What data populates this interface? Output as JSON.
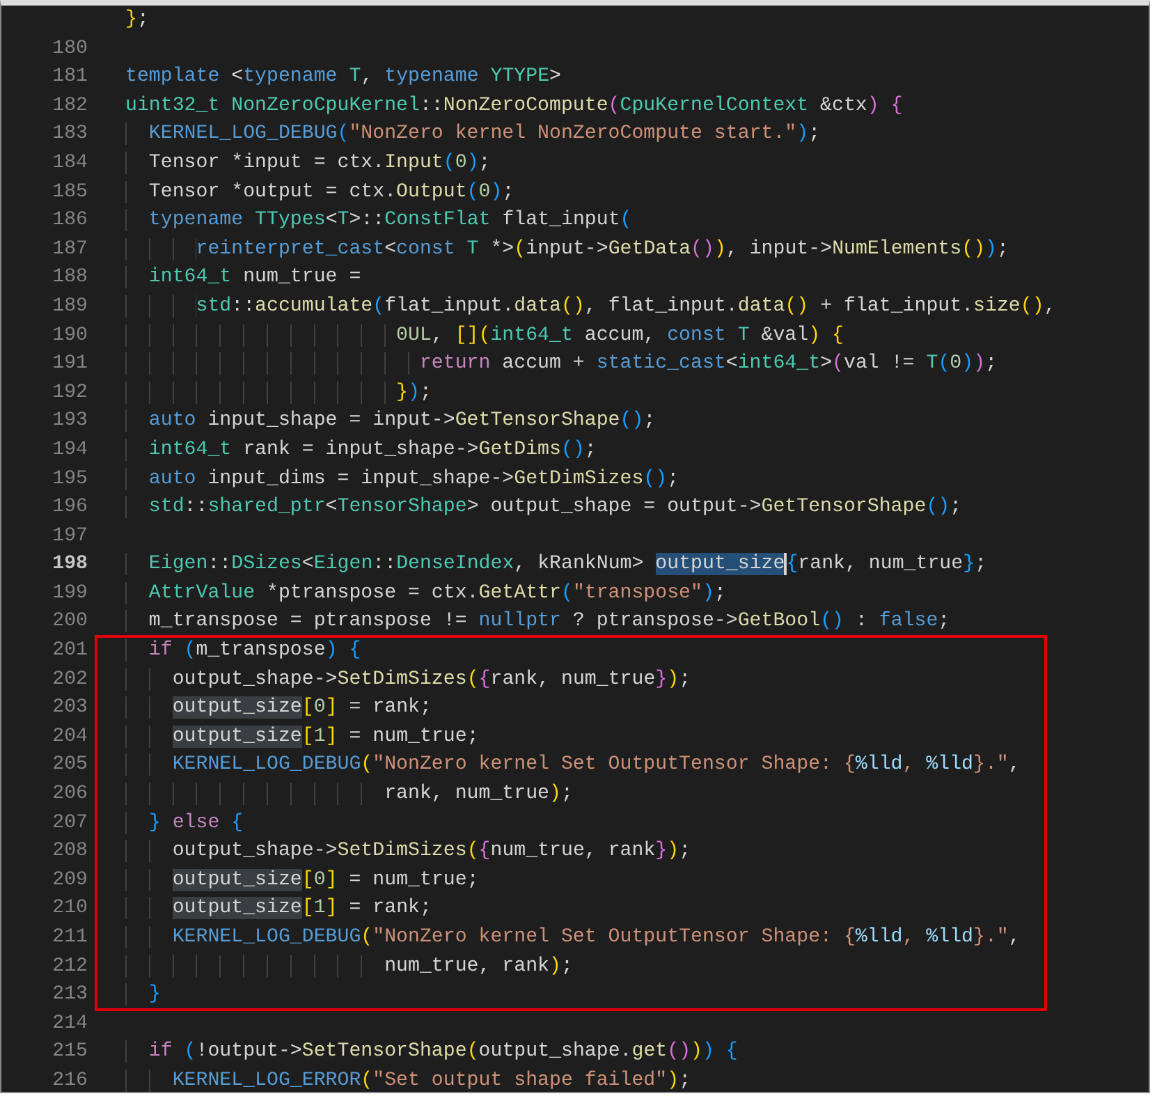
{
  "editor": {
    "sections": [
      {
        "boxed": false,
        "lines": [
          {
            "code": [
              {
                "kind": "y",
                "text": "}"
              },
              {
                "kind": "p",
                "text": ";"
              }
            ]
          },
          {
            "number": "180"
          },
          {
            "number": "181",
            "code": [
              {
                "kind": "k",
                "text": "template"
              },
              {
                "kind": "p",
                "text": " <"
              },
              {
                "kind": "k",
                "text": "typename"
              },
              {
                "kind": "t",
                "text": " T"
              },
              {
                "kind": "p",
                "text": ", "
              },
              {
                "kind": "k",
                "text": "typename"
              },
              {
                "kind": "t",
                "text": " YTYPE"
              },
              {
                "kind": "p",
                "text": ">"
              }
            ]
          },
          {
            "number": "182",
            "code": [
              {
                "kind": "t",
                "text": "uint32_t NonZeroCpuKernel"
              },
              {
                "kind": "p",
                "text": "::"
              },
              {
                "kind": "f",
                "text": "NonZeroCompute"
              },
              {
                "kind": "v",
                "text": "("
              },
              {
                "kind": "t",
                "text": "CpuKernelContext"
              },
              {
                "kind": "p",
                "text": " &ctx"
              },
              {
                "kind": "v",
                "text": ")"
              },
              {
                "kind": "v",
                "text": " {"
              }
            ]
          },
          {
            "number": "183",
            "code": [
              {
                "kind": "k",
                "text": "  KERNEL_LOG_DEBUG"
              },
              {
                "kind": "b",
                "text": "("
              },
              {
                "kind": "s",
                "text": "\"NonZero kernel NonZeroCompute start.\""
              },
              {
                "kind": "b",
                "text": ")"
              },
              {
                "kind": "p",
                "text": ";"
              }
            ]
          },
          {
            "number": "184",
            "code": [
              {
                "kind": "p",
                "text": "  Tensor *input = ctx."
              },
              {
                "kind": "f",
                "text": "Input"
              },
              {
                "kind": "b",
                "text": "("
              },
              {
                "kind": "n",
                "text": "0"
              },
              {
                "kind": "b",
                "text": ")"
              },
              {
                "kind": "p",
                "text": ";"
              }
            ]
          },
          {
            "number": "185",
            "code": [
              {
                "kind": "p",
                "text": "  Tensor *output = ctx."
              },
              {
                "kind": "f",
                "text": "Output"
              },
              {
                "kind": "b",
                "text": "("
              },
              {
                "kind": "n",
                "text": "0"
              },
              {
                "kind": "b",
                "text": ")"
              },
              {
                "kind": "p",
                "text": ";"
              }
            ]
          },
          {
            "number": "186",
            "code": [
              {
                "kind": "k",
                "text": "  typename"
              },
              {
                "kind": "t",
                "text": " TTypes"
              },
              {
                "kind": "p",
                "text": "<"
              },
              {
                "kind": "t",
                "text": "T"
              },
              {
                "kind": "p",
                "text": ">::"
              },
              {
                "kind": "t",
                "text": "ConstFlat"
              },
              {
                "kind": "p",
                "text": " flat_input"
              },
              {
                "kind": "b",
                "text": "("
              }
            ]
          },
          {
            "number": "187",
            "code": [
              {
                "kind": "k",
                "text": "      reinterpret_cast"
              },
              {
                "kind": "p",
                "text": "<"
              },
              {
                "kind": "k",
                "text": "const"
              },
              {
                "kind": "t",
                "text": " T"
              },
              {
                "kind": "p",
                "text": " *>"
              },
              {
                "kind": "y",
                "text": "("
              },
              {
                "kind": "p",
                "text": "input->"
              },
              {
                "kind": "f",
                "text": "GetData"
              },
              {
                "kind": "v",
                "text": "()"
              },
              {
                "kind": "y",
                "text": ")"
              },
              {
                "kind": "p",
                "text": ", input->"
              },
              {
                "kind": "f",
                "text": "NumElements"
              },
              {
                "kind": "y",
                "text": "()"
              },
              {
                "kind": "b",
                "text": ")"
              },
              {
                "kind": "p",
                "text": ";"
              }
            ]
          },
          {
            "number": "188",
            "code": [
              {
                "kind": "t",
                "text": "  int64_t"
              },
              {
                "kind": "p",
                "text": " num_true ="
              }
            ]
          },
          {
            "number": "189",
            "code": [
              {
                "kind": "t",
                "text": "      std"
              },
              {
                "kind": "p",
                "text": "::"
              },
              {
                "kind": "f",
                "text": "accumulate"
              },
              {
                "kind": "b",
                "text": "("
              },
              {
                "kind": "p",
                "text": "flat_input."
              },
              {
                "kind": "f",
                "text": "data"
              },
              {
                "kind": "y",
                "text": "()"
              },
              {
                "kind": "p",
                "text": ", flat_input."
              },
              {
                "kind": "f",
                "text": "data"
              },
              {
                "kind": "y",
                "text": "()"
              },
              {
                "kind": "p",
                "text": " + flat_input."
              },
              {
                "kind": "f",
                "text": "size"
              },
              {
                "kind": "y",
                "text": "()"
              },
              {
                "kind": "p",
                "text": ","
              }
            ]
          },
          {
            "number": "190",
            "code": [
              {
                "kind": "n",
                "text": "                       0UL"
              },
              {
                "kind": "p",
                "text": ", "
              },
              {
                "kind": "y",
                "text": "[]("
              },
              {
                "kind": "t",
                "text": "int64_t"
              },
              {
                "kind": "p",
                "text": " accum, "
              },
              {
                "kind": "k",
                "text": "const"
              },
              {
                "kind": "t",
                "text": " T"
              },
              {
                "kind": "p",
                "text": " &val"
              },
              {
                "kind": "y",
                "text": ")"
              },
              {
                "kind": "y",
                "text": " {"
              }
            ]
          },
          {
            "number": "191",
            "code": [
              {
                "kind": "c",
                "text": "                         return"
              },
              {
                "kind": "p",
                "text": " accum + "
              },
              {
                "kind": "k",
                "text": "static_cast"
              },
              {
                "kind": "p",
                "text": "<"
              },
              {
                "kind": "t",
                "text": "int64_t"
              },
              {
                "kind": "p",
                "text": ">"
              },
              {
                "kind": "v",
                "text": "("
              },
              {
                "kind": "p",
                "text": "val != "
              },
              {
                "kind": "t",
                "text": "T"
              },
              {
                "kind": "b",
                "text": "("
              },
              {
                "kind": "n",
                "text": "0"
              },
              {
                "kind": "b",
                "text": ")"
              },
              {
                "kind": "v",
                "text": ")"
              },
              {
                "kind": "p",
                "text": ";"
              }
            ]
          },
          {
            "number": "192",
            "code": [
              {
                "kind": "y",
                "text": "                       }"
              },
              {
                "kind": "b",
                "text": ")"
              },
              {
                "kind": "p",
                "text": ";"
              }
            ]
          },
          {
            "number": "193",
            "code": [
              {
                "kind": "k",
                "text": "  auto"
              },
              {
                "kind": "p",
                "text": " input_shape = input->"
              },
              {
                "kind": "f",
                "text": "GetTensorShape"
              },
              {
                "kind": "b",
                "text": "()"
              },
              {
                "kind": "p",
                "text": ";"
              }
            ]
          },
          {
            "number": "194",
            "code": [
              {
                "kind": "t",
                "text": "  int64_t"
              },
              {
                "kind": "p",
                "text": " rank = input_shape->"
              },
              {
                "kind": "f",
                "text": "GetDims"
              },
              {
                "kind": "b",
                "text": "()"
              },
              {
                "kind": "p",
                "text": ";"
              }
            ]
          },
          {
            "number": "195",
            "code": [
              {
                "kind": "k",
                "text": "  auto"
              },
              {
                "kind": "p",
                "text": " input_dims = input_shape->"
              },
              {
                "kind": "f",
                "text": "GetDimSizes"
              },
              {
                "kind": "b",
                "text": "()"
              },
              {
                "kind": "p",
                "text": ";"
              }
            ]
          },
          {
            "number": "196",
            "code": [
              {
                "kind": "t",
                "text": "  std"
              },
              {
                "kind": "p",
                "text": "::"
              },
              {
                "kind": "t",
                "text": "shared_ptr"
              },
              {
                "kind": "p",
                "text": "<"
              },
              {
                "kind": "t",
                "text": "TensorShape"
              },
              {
                "kind": "p",
                "text": "> output_shape = output->"
              },
              {
                "kind": "f",
                "text": "GetTensorShape"
              },
              {
                "kind": "b",
                "text": "()"
              },
              {
                "kind": "p",
                "text": ";"
              }
            ]
          },
          {
            "number": "197"
          },
          {
            "number": "198",
            "current": true,
            "code": [
              {
                "kind": "t",
                "text": "  Eigen"
              },
              {
                "kind": "p",
                "text": "::"
              },
              {
                "kind": "t",
                "text": "DSizes"
              },
              {
                "kind": "p",
                "text": "<"
              },
              {
                "kind": "t",
                "text": "Eigen"
              },
              {
                "kind": "p",
                "text": "::"
              },
              {
                "kind": "t",
                "text": "DenseIndex"
              },
              {
                "kind": "p",
                "text": ", kRankNum> "
              },
              {
                "kind": "sel",
                "text": "output_size"
              },
              {
                "kind": "b",
                "text": "{"
              },
              {
                "kind": "p",
                "text": "rank, num_true"
              },
              {
                "kind": "b",
                "text": "}"
              },
              {
                "kind": "p",
                "text": ";"
              }
            ]
          },
          {
            "number": "199",
            "code": [
              {
                "kind": "t",
                "text": "  AttrValue"
              },
              {
                "kind": "p",
                "text": " *ptranspose = ctx."
              },
              {
                "kind": "f",
                "text": "GetAttr"
              },
              {
                "kind": "b",
                "text": "("
              },
              {
                "kind": "s",
                "text": "\"transpose\""
              },
              {
                "kind": "b",
                "text": ")"
              },
              {
                "kind": "p",
                "text": ";"
              }
            ]
          },
          {
            "number": "200",
            "code": [
              {
                "kind": "p",
                "text": "  m_transpose = ptranspose != "
              },
              {
                "kind": "k",
                "text": "nullptr"
              },
              {
                "kind": "p",
                "text": " ? ptranspose->"
              },
              {
                "kind": "f",
                "text": "GetBool"
              },
              {
                "kind": "b",
                "text": "()"
              },
              {
                "kind": "p",
                "text": " : "
              },
              {
                "kind": "k",
                "text": "false"
              },
              {
                "kind": "p",
                "text": ";"
              }
            ]
          }
        ]
      },
      {
        "boxed": true,
        "lines": [
          {
            "number": "201",
            "code": [
              {
                "kind": "c",
                "text": "  if"
              },
              {
                "kind": "b",
                "text": " ("
              },
              {
                "kind": "p",
                "text": "m_transpose"
              },
              {
                "kind": "b",
                "text": ")"
              },
              {
                "kind": "b",
                "text": " {"
              }
            ]
          },
          {
            "number": "202",
            "code": [
              {
                "kind": "p",
                "text": "    output_shape->"
              },
              {
                "kind": "f",
                "text": "SetDimSizes"
              },
              {
                "kind": "y",
                "text": "("
              },
              {
                "kind": "v",
                "text": "{"
              },
              {
                "kind": "p",
                "text": "rank, num_true"
              },
              {
                "kind": "v",
                "text": "}"
              },
              {
                "kind": "y",
                "text": ")"
              },
              {
                "kind": "p",
                "text": ";"
              }
            ]
          },
          {
            "number": "203",
            "code": [
              {
                "kind": "hl",
                "text": "    output_size"
              },
              {
                "kind": "y",
                "text": "["
              },
              {
                "kind": "n",
                "text": "0"
              },
              {
                "kind": "y",
                "text": "]"
              },
              {
                "kind": "p",
                "text": " = rank;"
              }
            ]
          },
          {
            "number": "204",
            "code": [
              {
                "kind": "hl",
                "text": "    output_size"
              },
              {
                "kind": "y",
                "text": "["
              },
              {
                "kind": "n",
                "text": "1"
              },
              {
                "kind": "y",
                "text": "]"
              },
              {
                "kind": "p",
                "text": " = num_true;"
              }
            ]
          },
          {
            "number": "205",
            "code": [
              {
                "kind": "k",
                "text": "    KERNEL_LOG_DEBUG"
              },
              {
                "kind": "y",
                "text": "("
              },
              {
                "kind": "s",
                "text": "\"NonZero kernel Set OutputTensor Shape: {"
              },
              {
                "kind": "e",
                "text": "%lld"
              },
              {
                "kind": "s",
                "text": ", "
              },
              {
                "kind": "e",
                "text": "%lld"
              },
              {
                "kind": "s",
                "text": "}.\""
              },
              {
                "kind": "p",
                "text": ","
              }
            ]
          },
          {
            "number": "206",
            "code": [
              {
                "kind": "p",
                "text": "                      rank, num_true"
              },
              {
                "kind": "y",
                "text": ")"
              },
              {
                "kind": "p",
                "text": ";"
              }
            ]
          },
          {
            "number": "207",
            "code": [
              {
                "kind": "b",
                "text": "  }"
              },
              {
                "kind": "c",
                "text": " else"
              },
              {
                "kind": "b",
                "text": " {"
              }
            ]
          },
          {
            "number": "208",
            "code": [
              {
                "kind": "p",
                "text": "    output_shape->"
              },
              {
                "kind": "f",
                "text": "SetDimSizes"
              },
              {
                "kind": "y",
                "text": "("
              },
              {
                "kind": "v",
                "text": "{"
              },
              {
                "kind": "p",
                "text": "num_true, rank"
              },
              {
                "kind": "v",
                "text": "}"
              },
              {
                "kind": "y",
                "text": ")"
              },
              {
                "kind": "p",
                "text": ";"
              }
            ]
          },
          {
            "number": "209",
            "code": [
              {
                "kind": "hl",
                "text": "    output_size"
              },
              {
                "kind": "y",
                "text": "["
              },
              {
                "kind": "n",
                "text": "0"
              },
              {
                "kind": "y",
                "text": "]"
              },
              {
                "kind": "p",
                "text": " = num_true;"
              }
            ]
          },
          {
            "number": "210",
            "code": [
              {
                "kind": "hl",
                "text": "    output_size"
              },
              {
                "kind": "y",
                "text": "["
              },
              {
                "kind": "n",
                "text": "1"
              },
              {
                "kind": "y",
                "text": "]"
              },
              {
                "kind": "p",
                "text": " = rank;"
              }
            ]
          },
          {
            "number": "211",
            "code": [
              {
                "kind": "k",
                "text": "    KERNEL_LOG_DEBUG"
              },
              {
                "kind": "y",
                "text": "("
              },
              {
                "kind": "s",
                "text": "\"NonZero kernel Set OutputTensor Shape: {"
              },
              {
                "kind": "e",
                "text": "%lld"
              },
              {
                "kind": "s",
                "text": ", "
              },
              {
                "kind": "e",
                "text": "%lld"
              },
              {
                "kind": "s",
                "text": "}.\""
              },
              {
                "kind": "p",
                "text": ","
              }
            ]
          },
          {
            "number": "212",
            "code": [
              {
                "kind": "p",
                "text": "                      num_true, rank"
              },
              {
                "kind": "y",
                "text": ")"
              },
              {
                "kind": "p",
                "text": ";"
              }
            ]
          },
          {
            "number": "213",
            "code": [
              {
                "kind": "b",
                "text": "  }"
              }
            ]
          }
        ]
      },
      {
        "boxed": false,
        "lines": [
          {
            "number": "214"
          },
          {
            "number": "215",
            "code": [
              {
                "kind": "c",
                "text": "  if"
              },
              {
                "kind": "b",
                "text": " ("
              },
              {
                "kind": "p",
                "text": "!output->"
              },
              {
                "kind": "f",
                "text": "SetTensorShape"
              },
              {
                "kind": "y",
                "text": "("
              },
              {
                "kind": "p",
                "text": "output_shape."
              },
              {
                "kind": "f",
                "text": "get"
              },
              {
                "kind": "v",
                "text": "()"
              },
              {
                "kind": "y",
                "text": ")"
              },
              {
                "kind": "b",
                "text": ")"
              },
              {
                "kind": "b",
                "text": " {"
              }
            ]
          },
          {
            "number": "216",
            "code": [
              {
                "kind": "k",
                "text": "    KERNEL_LOG_ERROR"
              },
              {
                "kind": "y",
                "text": "("
              },
              {
                "kind": "s",
                "text": "\"Set output shape failed\""
              },
              {
                "kind": "y",
                "text": ")"
              },
              {
                "kind": "p",
                "text": ";"
              }
            ]
          }
        ]
      }
    ]
  }
}
